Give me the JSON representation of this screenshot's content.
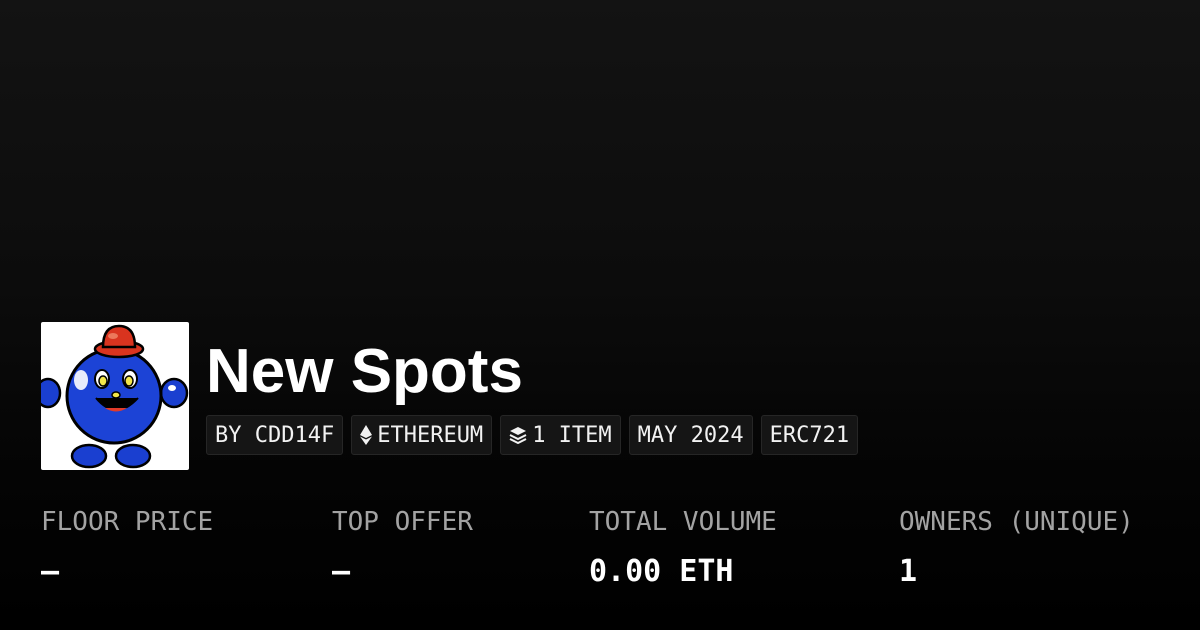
{
  "collection": {
    "name": "New Spots",
    "avatar_icon": "blue-mascot-with-red-hat-icon"
  },
  "badges": [
    {
      "label": "BY CDD14F",
      "icon": null
    },
    {
      "label": "ETHEREUM",
      "icon": "ethereum-icon"
    },
    {
      "label": "1 ITEM",
      "icon": "layers-icon"
    },
    {
      "label": "MAY 2024",
      "icon": null
    },
    {
      "label": "ERC721",
      "icon": null
    }
  ],
  "stats": [
    {
      "label": "FLOOR PRICE",
      "value": "–"
    },
    {
      "label": "TOP OFFER",
      "value": "–"
    },
    {
      "label": "TOTAL VOLUME",
      "value": "0.00 ETH"
    },
    {
      "label": "OWNERS (UNIQUE)",
      "value": "1"
    }
  ],
  "colors": {
    "background": "#000000",
    "text": "#ffffff",
    "muted_text": "#a3a3a3",
    "badge_bg": "#151515"
  }
}
